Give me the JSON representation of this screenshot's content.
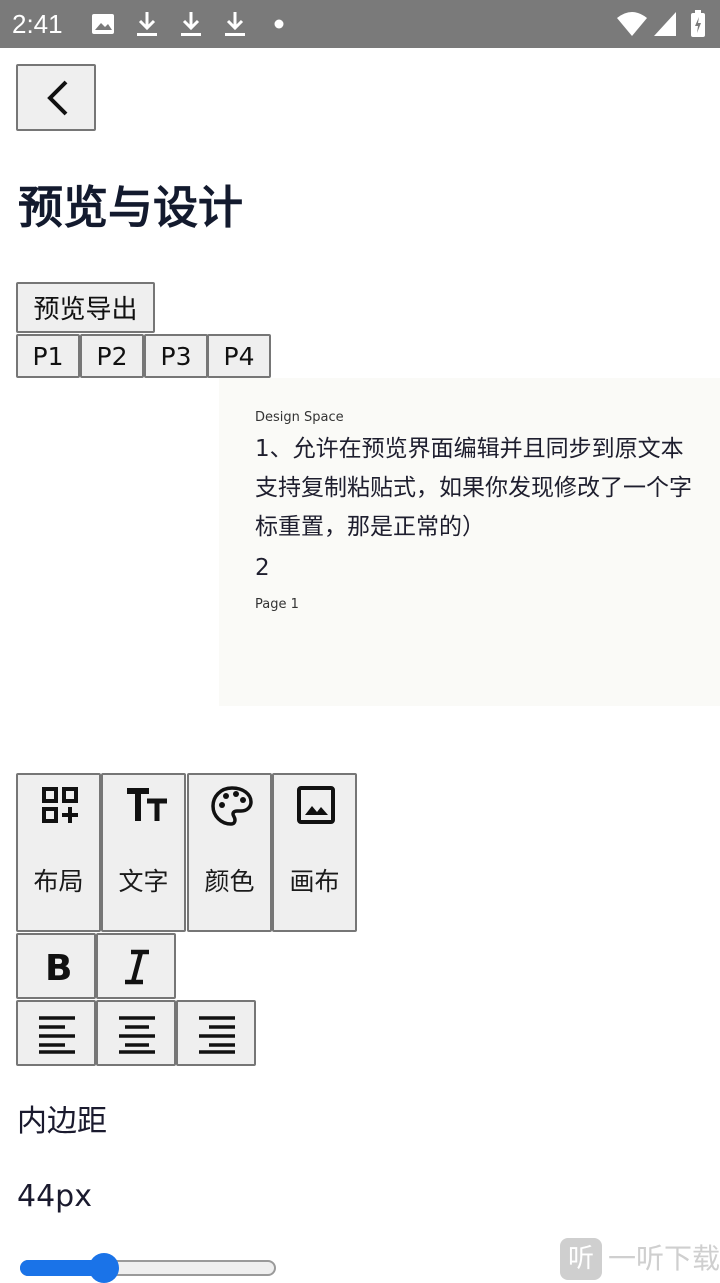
{
  "status_bar": {
    "time": "2:41",
    "icons": [
      "image-icon",
      "download-icon",
      "download-icon",
      "download-icon",
      "dot-icon",
      "wifi-icon",
      "signal-icon",
      "battery-icon"
    ]
  },
  "header": {
    "back_icon": "chevron-left-icon",
    "title": "预览与设计"
  },
  "toolbar": {
    "export_label": "预览导出",
    "pages": [
      "P1",
      "P2",
      "P3",
      "P4"
    ]
  },
  "design_space": {
    "label": "Design Space",
    "lines": [
      "1、允许在预览界面编辑并且同步到原文本",
      "支持复制粘贴式，如果你发现修改了一个字",
      "标重置，那是正常的）"
    ],
    "number": "2",
    "page_label": "Page 1"
  },
  "tools": [
    {
      "icon": "layout-add-icon",
      "label": "布局"
    },
    {
      "icon": "text-size-icon",
      "label": "文字"
    },
    {
      "icon": "palette-icon",
      "label": "颜色"
    },
    {
      "icon": "image-icon",
      "label": "画布"
    }
  ],
  "format": {
    "bold_icon": "bold-icon",
    "italic_icon": "italic-icon",
    "align_icons": [
      "align-left-icon",
      "align-center-icon",
      "align-right-icon"
    ]
  },
  "padding": {
    "label": "内边距",
    "value": "44px",
    "slider_fraction": 0.33
  },
  "watermark": {
    "badge": "听",
    "text": "一听下载"
  },
  "colors": {
    "accent": "#1a73e8",
    "status_bar": "#7a7a7a",
    "design_space_bg": "#fafaf7"
  }
}
